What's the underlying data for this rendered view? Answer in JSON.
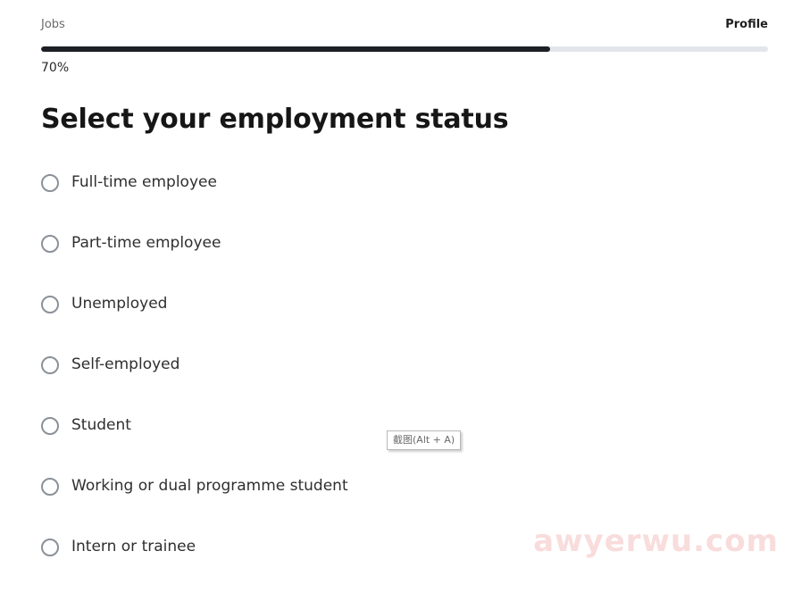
{
  "progress": {
    "steps": {
      "left": "Jobs",
      "right": "Profile"
    },
    "percent_label": "70%",
    "fraction": 0.7
  },
  "page": {
    "title": "Select your employment status"
  },
  "options": [
    {
      "label": "Full-time employee",
      "selected": false
    },
    {
      "label": "Part-time employee",
      "selected": false
    },
    {
      "label": "Unemployed",
      "selected": false
    },
    {
      "label": "Self-employed",
      "selected": false
    },
    {
      "label": "Student",
      "selected": false
    },
    {
      "label": "Working or dual programme student",
      "selected": false
    },
    {
      "label": "Intern or trainee",
      "selected": false
    }
  ],
  "tooltip": {
    "text": "截图(Alt + A)"
  },
  "watermark": {
    "text": "awyerwu.com"
  },
  "colors": {
    "progress_fill": "#1c1f24",
    "progress_track": "#e3e6ea",
    "radio_border": "#8b9198"
  }
}
